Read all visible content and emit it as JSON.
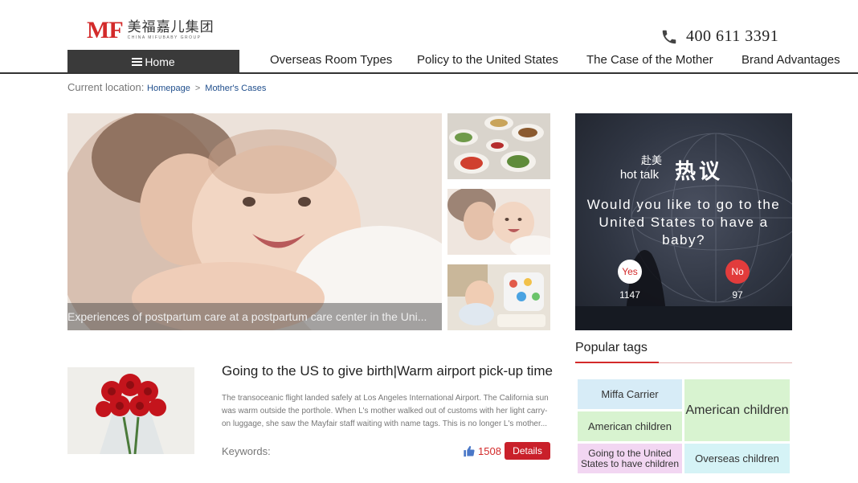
{
  "brand": {
    "logo_mark": "MF",
    "logo_cn": "美福嘉儿集团",
    "logo_en": "CHINA MIFUBABY GROUP"
  },
  "contact": {
    "phone_icon": "phone-icon",
    "phone": "400 611 3391"
  },
  "nav": {
    "home": "Home",
    "items": [
      {
        "label": "Overseas Room Types"
      },
      {
        "label": "Policy to the United States"
      },
      {
        "label": "The Case of the Mother"
      },
      {
        "label": "Brand Advantages"
      }
    ]
  },
  "breadcrumb": {
    "prefix": "Current location:",
    "items": [
      "Homepage",
      "Mother's Cases"
    ],
    "separator": ">"
  },
  "hero": {
    "caption": "Experiences of postpartum care at a postpartum care center in the Uni..."
  },
  "hot_talk": {
    "small_cn": "赴美",
    "small_en": "hot talk",
    "big_cn": "热议",
    "question": "Would you like to go to the United States to have a baby?",
    "yes_label": "Yes",
    "no_label": "No",
    "yes_count": "1147",
    "no_count": "97"
  },
  "popular_tags": {
    "title": "Popular tags",
    "tags": [
      {
        "label": "Miffa Carrier",
        "color": "#d7ecf7"
      },
      {
        "label": "American children",
        "color": "#d8f3d0"
      },
      {
        "label": "American children",
        "color": "#d8f3d0"
      },
      {
        "label": "Going to the United States to have children",
        "color": "#f2d6f2"
      },
      {
        "label": "Overseas children",
        "color": "#d5f3f6"
      }
    ]
  },
  "article": {
    "title": "Going to the US to give birth|Warm airport pick-up time",
    "body": "The transoceanic flight landed safely at Los Angeles International Airport. The California sun was warm outside the porthole. When L's mother walked out of customs with her light carry-on luggage, she saw the Mayfair staff waiting with name tags. This is no longer L's mother...",
    "keywords_label": "Keywords:",
    "likes": "1508",
    "details_label": "Details"
  },
  "colors": {
    "brand_red": "#d32a2a",
    "nav_dark": "#3a3a3a",
    "link_blue": "#1f4e8c"
  }
}
